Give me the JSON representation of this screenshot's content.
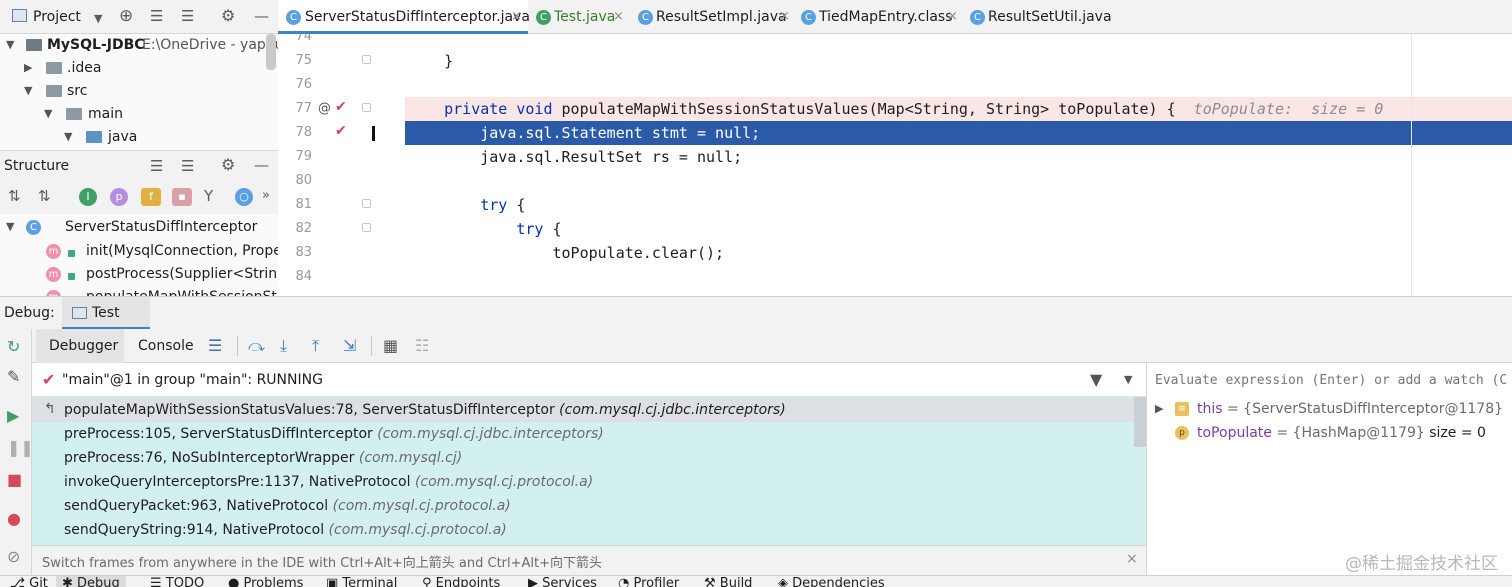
{
  "project_panel": {
    "title": "Project",
    "tree": [
      {
        "label": "MySQL-JDBC",
        "path": "E:\\OneDrive - yapuu\\"
      },
      {
        "label": ".idea"
      },
      {
        "label": "src"
      },
      {
        "label": "main"
      },
      {
        "label": "java"
      }
    ]
  },
  "structure_panel": {
    "title": "Structure",
    "root": "ServerStatusDiffInterceptor",
    "items": [
      "init(MysqlConnection, Propert",
      "postProcess(Supplier<String>",
      "populateMapWithSessionStatu"
    ]
  },
  "tabs": [
    {
      "label": "ServerStatusDiffInterceptor.java",
      "active": true
    },
    {
      "label": "Test.java"
    },
    {
      "label": "ResultSetImpl.java"
    },
    {
      "label": "TiedMapEntry.class"
    },
    {
      "label": "ResultSetUtil.java"
    }
  ],
  "editor": {
    "line_numbers": [
      "74",
      "75",
      "76",
      "77",
      "78",
      "79",
      "80",
      "81",
      "82",
      "83",
      "84"
    ],
    "lines": {
      "l75": "    }",
      "l77_kw": "    private void ",
      "l77_rest": "populateMapWithSessionStatusValues(Map<String, String> toPopulate) {",
      "l77_hint": "  toPopulate:  size = 0",
      "l78": "        java.sql.Statement stmt = null;",
      "l79": "        java.sql.ResultSet rs = null;",
      "l81_kw": "        try",
      "l81_rest": " {",
      "l82_kw": "            try",
      "l82_rest": " {",
      "l83": "                toPopulate.clear();"
    }
  },
  "debug": {
    "label": "Debug:",
    "config_tab": "Test",
    "tabs": {
      "debugger": "Debugger",
      "console": "Console"
    },
    "thread": "\"main\"@1 in group \"main\": RUNNING",
    "frames": [
      {
        "method": "populateMapWithSessionStatusValues:78, ServerStatusDiffInterceptor",
        "pkg": "(com.mysql.cj.jdbc.interceptors)"
      },
      {
        "method": "preProcess:105, ServerStatusDiffInterceptor",
        "pkg": "(com.mysql.cj.jdbc.interceptors)"
      },
      {
        "method": "preProcess:76, NoSubInterceptorWrapper",
        "pkg": "(com.mysql.cj)"
      },
      {
        "method": "invokeQueryInterceptorsPre:1137, NativeProtocol",
        "pkg": "(com.mysql.cj.protocol.a)"
      },
      {
        "method": "sendQueryPacket:963, NativeProtocol",
        "pkg": "(com.mysql.cj.protocol.a)"
      },
      {
        "method": "sendQueryString:914, NativeProtocol",
        "pkg": "(com.mysql.cj.protocol.a)"
      }
    ],
    "hint": "Switch frames from anywhere in the IDE with Ctrl+Alt+向上箭头 and Ctrl+Alt+向下箭头",
    "eval_placeholder": "Evaluate expression (Enter) or add a watch (C",
    "variables": [
      {
        "name": "this",
        "value": "= {ServerStatusDiffInterceptor@1178}"
      },
      {
        "name": "toPopulate",
        "value": "= {HashMap@1179}",
        "extra": " size = 0"
      }
    ]
  },
  "bottom_tabs": [
    "Git",
    "Debug",
    "TODO",
    "Problems",
    "Terminal",
    "Endpoints",
    "Services",
    "Profiler",
    "Build",
    "Dependencies"
  ],
  "watermark": "@稀土掘金技术社区"
}
